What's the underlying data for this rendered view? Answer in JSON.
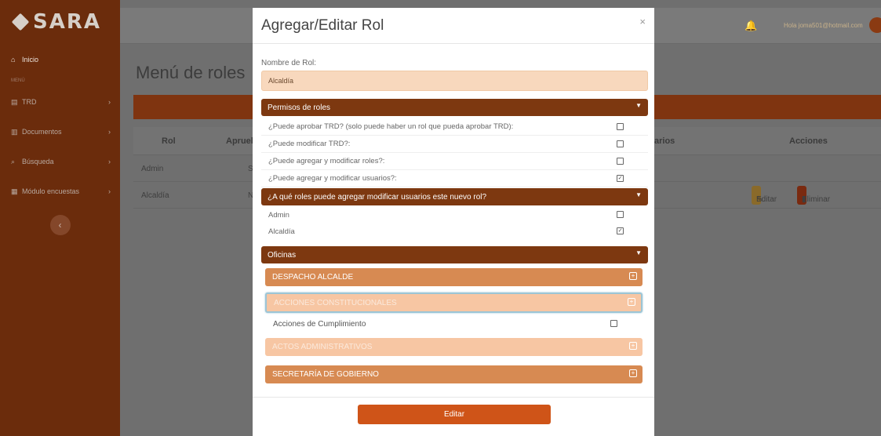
{
  "sidebar": {
    "logo_text": "SARA",
    "menu_label": "MENÚ",
    "collapse_glyph": "‹",
    "items": [
      {
        "label": "Inicio",
        "icon": "home-icon",
        "glyph": "⌂"
      },
      {
        "label": "TRD",
        "icon": "table-icon",
        "glyph": "▤"
      },
      {
        "label": "Documentos",
        "icon": "document-icon",
        "glyph": "▥"
      },
      {
        "label": "Búsqueda",
        "icon": "search-icon",
        "glyph": "⌕"
      },
      {
        "label": "Módulo encuestas",
        "icon": "survey-icon",
        "glyph": "▦"
      }
    ],
    "chevron": "›"
  },
  "topbar": {
    "bell_glyph": "🔔",
    "greeting": "Hola joma501@hotmail.com"
  },
  "page": {
    "title": "Menú de roles",
    "table": {
      "headers": [
        "Rol",
        "Aprueb",
        "arios",
        "Acciones"
      ],
      "rows": [
        {
          "rol": "Admin",
          "aprueba": "S"
        },
        {
          "rol": "Alcaldía",
          "aprueba": "N"
        }
      ],
      "edit_label": "Editar",
      "delete_label": "Eliminar"
    }
  },
  "modal": {
    "title": "Agregar/Editar Rol",
    "close_glyph": "×",
    "role_name_label": "Nombre de Rol:",
    "role_name_value": "Alcaldía",
    "permissions": {
      "header": "Permisos de roles",
      "items": [
        {
          "label": "¿Puede aprobar TRD? (solo puede haber un rol que pueda aprobar TRD):",
          "checked": false
        },
        {
          "label": "¿Puede modificar TRD?:",
          "checked": false
        },
        {
          "label": "¿Puede agregar y modificar roles?:",
          "checked": false
        },
        {
          "label": "¿Puede agregar y modificar usuarios?:",
          "checked": true
        }
      ]
    },
    "user_roles": {
      "header": "¿A qué roles puede agregar modificar usuarios este nuevo rol?",
      "items": [
        {
          "label": "Admin",
          "checked": false
        },
        {
          "label": "Alcaldía",
          "checked": true
        }
      ]
    },
    "offices": {
      "header": "Oficinas",
      "groups": [
        {
          "label": "DESPACHO ALCALDE",
          "style": "dark"
        },
        {
          "label": "ACCIONES CONSTITUCIONALES",
          "style": "light-focused"
        },
        {
          "label": "ACTOS ADMINISTRATIVOS",
          "style": "light"
        },
        {
          "label": "SECRETARÍA DE GOBIERNO",
          "style": "dark"
        }
      ],
      "sub_items": [
        {
          "label": "Acciones de Cumplimiento",
          "checked": false
        }
      ]
    },
    "caret_glyph": "▼",
    "expand_glyph": "+",
    "check_glyph": "✓",
    "submit_label": "Editar"
  },
  "colors": {
    "brand_dark": "#7d3810",
    "office_dark": "#d78a52",
    "office_light": "#f7c6a3",
    "submit": "#cf5418",
    "input_bg": "#f8d8bd"
  }
}
